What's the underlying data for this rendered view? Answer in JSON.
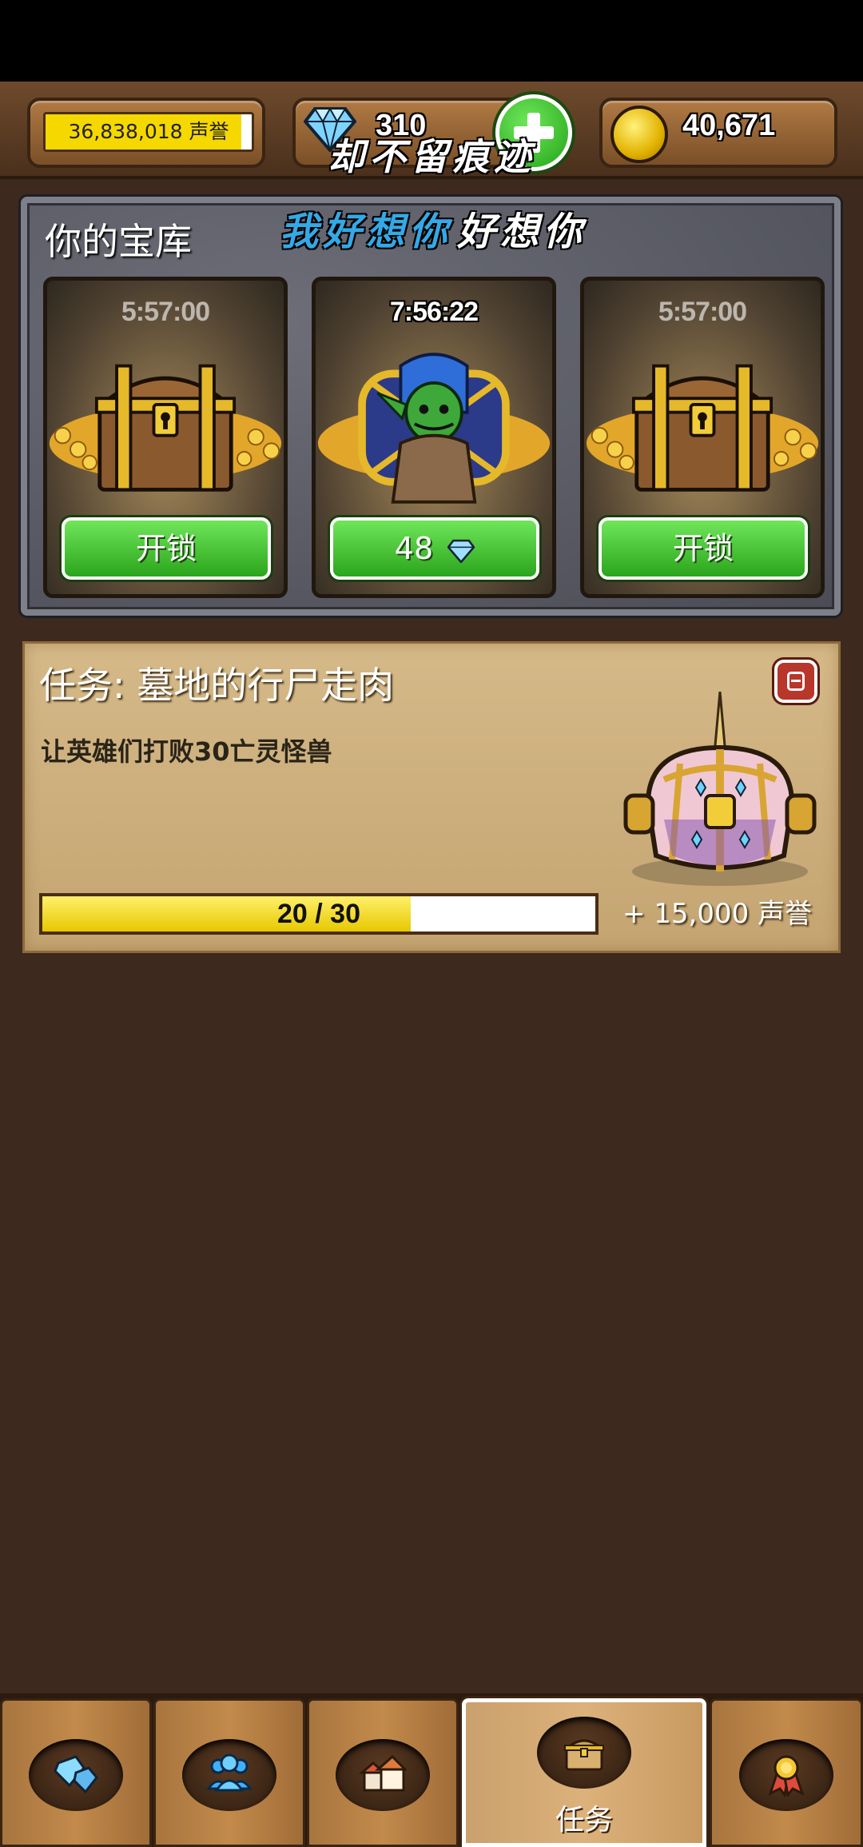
{
  "top_bar": {
    "honor": {
      "text": "36,838,018 声誉",
      "progress": 0.95
    },
    "gems": {
      "count": "310",
      "icon": "diamond-icon"
    },
    "gold": {
      "count": "40,671",
      "icon": "gold-coin-icon"
    }
  },
  "overlay": {
    "line1": "却不留痕迹",
    "line2_blue": "我好想你",
    "line2_white": "好想你"
  },
  "vault": {
    "title": "你的宝库",
    "chests": [
      {
        "timer": "5:57:00",
        "button": "开锁",
        "art": "wooden-chest"
      },
      {
        "timer": "7:56:22",
        "button": "48",
        "art": "goblin-chest",
        "button_icon": "diamond-icon"
      },
      {
        "timer": "5:57:00",
        "button": "开锁",
        "art": "wooden-chest"
      }
    ]
  },
  "quest": {
    "title": "任务: 墓地的行尸走肉",
    "description": "让英雄们打败30亡灵怪兽",
    "progress": {
      "current": 20,
      "total": 30,
      "text": "20 / 30"
    },
    "reward": "+ 15,000 声誉"
  },
  "nav": {
    "tabs": [
      {
        "icon": "gems-icon"
      },
      {
        "icon": "heroes-icon"
      },
      {
        "icon": "town-icon"
      },
      {
        "icon": "chest-icon",
        "label": "任务",
        "active": true
      },
      {
        "icon": "medal-icon"
      }
    ]
  },
  "colors": {
    "accent_green": "#2ba51c",
    "progress_yellow": "#f5d800",
    "background": "#3d291d"
  }
}
